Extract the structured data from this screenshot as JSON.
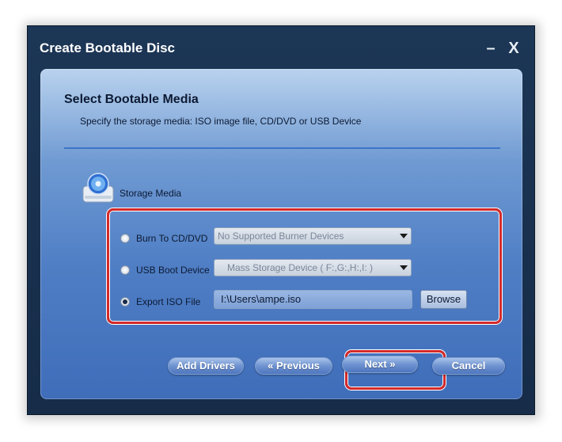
{
  "window": {
    "title": "Create Bootable Disc",
    "minimize_symbol": "–",
    "close_symbol": "X"
  },
  "header": {
    "heading": "Select Bootable Media",
    "subheading": "Specify the storage media: ISO image file, CD/DVD or USB Device"
  },
  "storage": {
    "label": "Storage Media",
    "icon": "disc-icon",
    "options": [
      {
        "label": "Burn To CD/DVD",
        "selected": false,
        "field_value": "No Supported Burner Devices"
      },
      {
        "label": "USB Boot Device",
        "selected": false,
        "field_value": "Mass Storage Device  ( F:,G:,H:,I: )"
      },
      {
        "label": "Export ISO File",
        "selected": true,
        "field_value": "I:\\Users\\ampe.iso"
      }
    ],
    "browse_label": "Browse"
  },
  "buttons": {
    "add_drivers": "Add Drivers",
    "previous": "« Previous",
    "next": "Next »",
    "cancel": "Cancel"
  },
  "colors": {
    "highlight": "#d42a2a",
    "frame": "#1c3656"
  }
}
